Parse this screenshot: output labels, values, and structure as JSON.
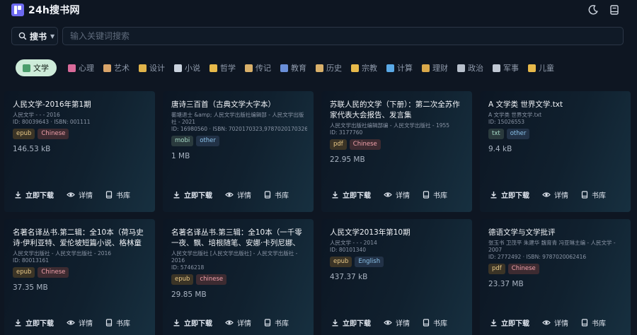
{
  "header": {
    "logo_text": "24h搜书网",
    "theme_icon": "moon-icon",
    "library_icon": "book-icon"
  },
  "search": {
    "scope_label": "搜书",
    "placeholder": "输入关键词搜索"
  },
  "categories": [
    {
      "label": "文学",
      "icon": "book-stack-icon",
      "color": "#4a9d6b",
      "active": true
    },
    {
      "label": "心理",
      "icon": "brain-icon",
      "color": "#d96a9a"
    },
    {
      "label": "艺术",
      "icon": "palette-icon",
      "color": "#d9a46a"
    },
    {
      "label": "设计",
      "icon": "pencil-icon",
      "color": "#e0b34a"
    },
    {
      "label": "小说",
      "icon": "open-book-icon",
      "color": "#c9d2de"
    },
    {
      "label": "哲学",
      "icon": "thinking-face-icon",
      "color": "#e7b94a"
    },
    {
      "label": "传记",
      "icon": "scroll-icon",
      "color": "#d9b06a"
    },
    {
      "label": "教育",
      "icon": "books-icon",
      "color": "#6a8fd9"
    },
    {
      "label": "历史",
      "icon": "scroll-icon",
      "color": "#d9b06a"
    },
    {
      "label": "宗教",
      "icon": "meditation-icon",
      "color": "#e7b94a"
    },
    {
      "label": "计算",
      "icon": "laptop-icon",
      "color": "#5aa9e6"
    },
    {
      "label": "理财",
      "icon": "money-bag-icon",
      "color": "#d9a84a"
    },
    {
      "label": "政治",
      "icon": "government-icon",
      "color": "#b8c0cc"
    },
    {
      "label": "军事",
      "icon": "swords-icon",
      "color": "#c0c8d4"
    },
    {
      "label": "儿童",
      "icon": "baby-icon",
      "color": "#e7b94a"
    }
  ],
  "actions": {
    "download": "立即下载",
    "details": "详情",
    "library": "书库"
  },
  "books": [
    {
      "title": "人民文学-2016年第1期",
      "meta": "人民文学 - - - 2016",
      "ids": "ID: 80039643 · ISBN: 001111",
      "tags": [
        {
          "label": "epub",
          "kind": "epub"
        },
        {
          "label": "Chinese",
          "kind": "chinese"
        }
      ],
      "size": "146.53 kB"
    },
    {
      "title": "唐诗三百首（古典文学大字本）",
      "meta": "蘅塘退士 &amp; 人民文学出版社编辑部 - 人民文学出版",
      "meta2": "社 - 2021",
      "ids": "ID: 16980560 · ISBN: 7020170323,9787020170326",
      "tags": [
        {
          "label": "mobi",
          "kind": "mobi"
        },
        {
          "label": "other",
          "kind": "other"
        }
      ],
      "size": "1 MB"
    },
    {
      "title": "苏联人民的文学（下册）：第二次全苏作家代表大会报告、发言集",
      "meta": "人民文学出版社编辑部编 - 人民文学出版社 - 1955",
      "ids": "ID: 3177760",
      "tags": [
        {
          "label": "pdf",
          "kind": "pdf"
        },
        {
          "label": "Chinese",
          "kind": "chinese"
        }
      ],
      "size": "22.95 MB"
    },
    {
      "title": "A 文学类 世界文学.txt",
      "meta": "A 文学类 世界文学.txt",
      "ids": "ID: 15026553",
      "tags": [
        {
          "label": "txt",
          "kind": "txt"
        },
        {
          "label": "other",
          "kind": "other"
        }
      ],
      "size": "9.4 kB"
    },
    {
      "title": "名著名译丛书.第二辑：全10本（荷马史诗·伊利亚特、爱伦坡短篇小说、格林童话...",
      "meta": "人民文学出版社 - 人民文学出版社 - 2016",
      "ids": "ID: 80013161",
      "tags": [
        {
          "label": "epub",
          "kind": "epub"
        },
        {
          "label": "Chinese",
          "kind": "chinese"
        }
      ],
      "size": "37.35 MB"
    },
    {
      "title": "名著名译丛书.第三辑：全10本（一千零一夜、飘、培根随笔、安娜·卡列尼娜、格...",
      "meta": "人民文学出版社 [人民文学出版社] - 人民文学出版社 -",
      "meta2": "2016",
      "ids": "ID: 5746218",
      "tags": [
        {
          "label": "epub",
          "kind": "epub"
        },
        {
          "label": "chinese",
          "kind": "chinese"
        }
      ],
      "size": "29.85 MB"
    },
    {
      "title": "人民文学2013年第10期",
      "meta": "人民文学 - - - 2014",
      "ids": "ID: 80101340",
      "tags": [
        {
          "label": "epub",
          "kind": "epub"
        },
        {
          "label": "English",
          "kind": "english"
        }
      ],
      "size": "437.37 kB"
    },
    {
      "title": "德语文学与文学批评",
      "meta": "张玉书 卫茂平 朱建华 魏育青 冯亚琳主编 - 人民文学 -",
      "meta2": "2007",
      "ids": "ID: 2772492 · ISBN: 9787020062416",
      "tags": [
        {
          "label": "pdf",
          "kind": "pdf"
        },
        {
          "label": "Chinese",
          "kind": "chinese"
        }
      ],
      "size": "23.37 MB"
    }
  ]
}
